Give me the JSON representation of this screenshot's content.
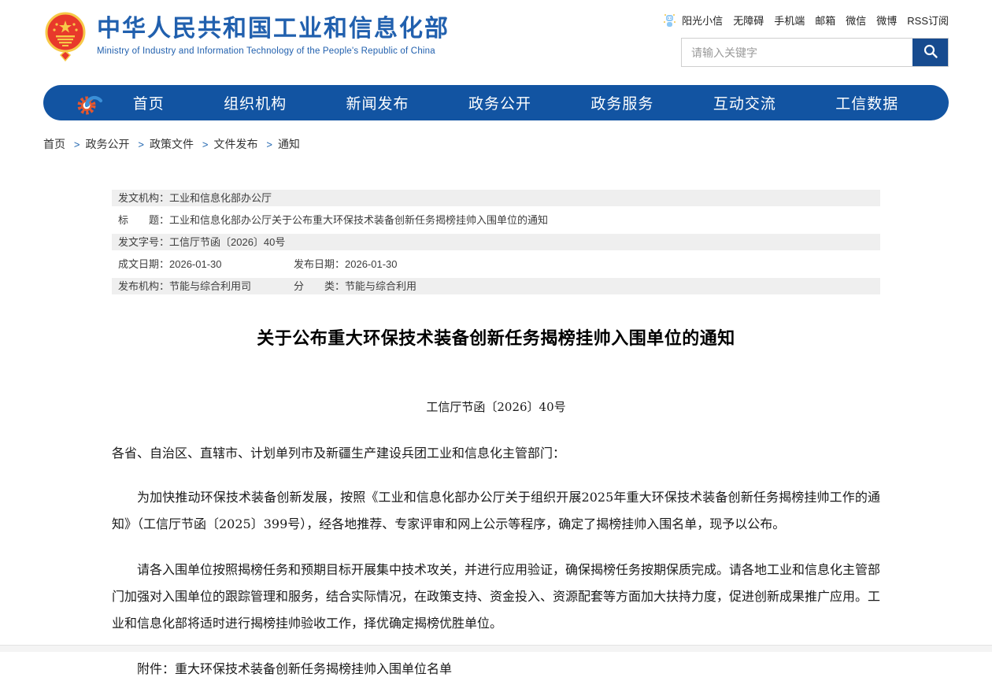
{
  "colors": {
    "brand_blue": "#2160ae",
    "nav_blue": "#1254a2",
    "search_button_navy": "#174b8f",
    "meta_row_gray": "#efefef",
    "gear_orange": "#e4572e",
    "emblem_red": "#e8392b",
    "emblem_gold": "#f7c948"
  },
  "header": {
    "site_title": "中华人民共和国工业和信息化部",
    "site_subtitle": "Ministry of Industry and Information Technology of the People's Republic of China",
    "top_links": [
      "阳光小信",
      "无障碍",
      "手机端",
      "邮箱",
      "微信",
      "微博",
      "RSS订阅"
    ],
    "search": {
      "placeholder": "请输入关键字"
    }
  },
  "nav": {
    "items": [
      "首页",
      "组织机构",
      "新闻发布",
      "政务公开",
      "政务服务",
      "互动交流",
      "工信数据"
    ]
  },
  "breadcrumb": {
    "separator": ">",
    "items": [
      "首页",
      "政务公开",
      "政策文件",
      "文件发布",
      "通知"
    ]
  },
  "meta_table": {
    "rows": [
      {
        "label": "发文机构：",
        "value": "工业和信息化部办公厅",
        "label2": "",
        "value2": ""
      },
      {
        "label": "标　　题：",
        "value": "工业和信息化部办公厅关于公布重大环保技术装备创新任务揭榜挂帅入围单位的通知",
        "label2": "",
        "value2": ""
      },
      {
        "label": "发文字号：",
        "value": "工信厅节函〔2026〕40号",
        "label2": "",
        "value2": ""
      },
      {
        "label": "成文日期：",
        "value": "2026-01-30",
        "label2": "发布日期：",
        "value2": "2026-01-30"
      },
      {
        "label": "发布机构：",
        "value": "节能与综合利用司",
        "label2": "分　　类：",
        "value2": "节能与综合利用"
      }
    ]
  },
  "document": {
    "title": "关于公布重大环保技术装备创新任务揭榜挂帅入围单位的通知",
    "doc_number": "工信厅节函〔2026〕40号",
    "salutation": "各省、自治区、直辖市、计划单列市及新疆生产建设兵团工业和信息化主管部门：",
    "paragraphs": [
      "为加快推动环保技术装备创新发展，按照《工业和信息化部办公厅关于组织开展2025年重大环保技术装备创新任务揭榜挂帅工作的通知》（工信厅节函〔2025〕399号），经各地推荐、专家评审和网上公示等程序，确定了揭榜挂帅入围名单，现予以公布。",
      "请各入围单位按照揭榜任务和预期目标开展集中技术攻关，并进行应用验证，确保揭榜任务按期保质完成。请各地工业和信息化主管部门加强对入围单位的跟踪管理和服务，结合实际情况，在政策支持、资金投入、资源配套等方面加大扶持力度，促进创新成果推广应用。工业和信息化部将适时进行揭榜挂帅验收工作，择优确定揭榜优胜单位。"
    ],
    "attachment_label": "附件：",
    "attachment_name": "重大环保技术装备创新任务揭榜挂帅入围单位名单"
  }
}
